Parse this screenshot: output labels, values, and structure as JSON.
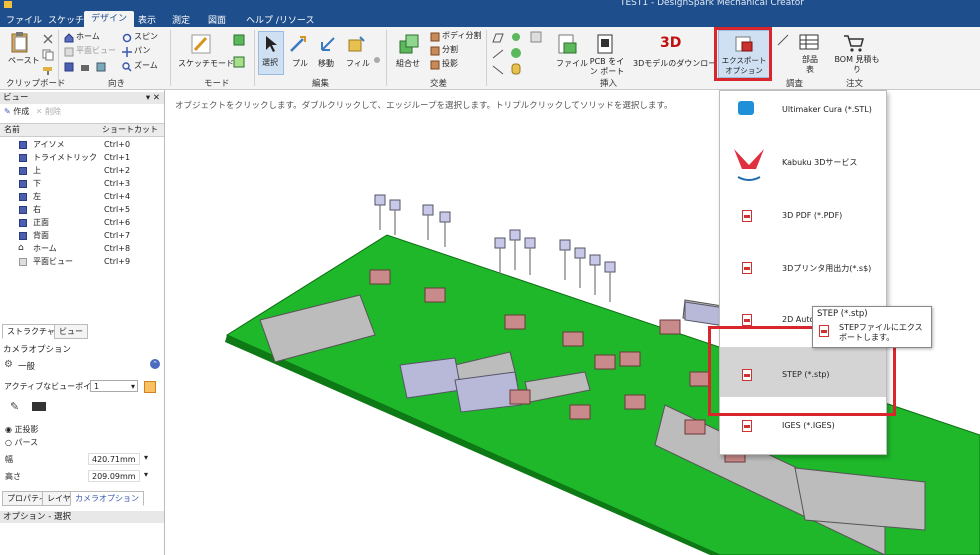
{
  "window": {
    "title": "TEST1 - DesignSpark Mechanical Creator"
  },
  "menu": {
    "tabs": [
      "ファイル",
      "スケッチ",
      "デザイン",
      "表示",
      "測定",
      "図面",
      "ヘルプ /リソース"
    ],
    "active": "デザイン"
  },
  "ribbon": {
    "clipboard": {
      "paste": "ペースト",
      "group": "クリップボード"
    },
    "orient": {
      "home": "ホーム",
      "plane_view": "平面ビュー",
      "spin": "スピン",
      "pan": "パン",
      "zoom": "ズーム",
      "group": "向き"
    },
    "mode": {
      "sketch_mode": "スケッチモード",
      "group": "モード"
    },
    "edit": {
      "select": "選択",
      "pull": "プル",
      "move": "移動",
      "fill": "フィル",
      "group": "編集"
    },
    "intersect": {
      "combine": "組合せ",
      "split_body": "ボディ分割",
      "split": "分割",
      "project": "投影",
      "group": "交差"
    },
    "insert": {
      "file": "ファイル",
      "pcb_import": "PCB をイン ポート",
      "3d_download": "3Dモデルのダウンロー",
      "group": "挿入"
    },
    "export_button": "エクスポート オプション",
    "parts": {
      "parts_table": "部品 表",
      "bom": "BOM 見積も り",
      "group_a": "調査",
      "group_b": "注文"
    }
  },
  "view_panel": {
    "title": "ビュー",
    "create": "作成",
    "delete": "削除",
    "columns": [
      "名前",
      "ショートカット"
    ],
    "rows": [
      {
        "name": "アイソメ",
        "key": "Ctrl+0"
      },
      {
        "name": "トライメトリック",
        "key": "Ctrl+1"
      },
      {
        "name": "上",
        "key": "Ctrl+2"
      },
      {
        "name": "下",
        "key": "Ctrl+3"
      },
      {
        "name": "左",
        "key": "Ctrl+4"
      },
      {
        "name": "右",
        "key": "Ctrl+5"
      },
      {
        "name": "正面",
        "key": "Ctrl+6"
      },
      {
        "name": "背面",
        "key": "Ctrl+7"
      },
      {
        "name": "ホーム",
        "key": "Ctrl+8"
      },
      {
        "name": "平面ビュー",
        "key": "Ctrl+9"
      }
    ],
    "tabs": [
      "ストラクチャー",
      "ビュー"
    ]
  },
  "camera": {
    "title": "カメラオプション",
    "section": "一般",
    "active_viewpoint_label": "アクティブなビューポイント",
    "active_viewpoint_value": "1",
    "ortho": "正投影",
    "perspective": "パース",
    "width_label": "幅",
    "width_value": "420.71mm",
    "height_label": "高さ",
    "height_value": "209.09mm"
  },
  "bottom_tabs": [
    "プロパティ",
    "レイヤ",
    "カメラオプション"
  ],
  "options_select": "オプション - 選択",
  "hint": "オブジェクトをクリックします。ダブルクリックして、エッジループを選択します。トリプルクリックしてソリッドを選択します。",
  "export_menu": [
    {
      "label": "Ultimaker Cura (*.STL)"
    },
    {
      "label": "Kabuku 3Dサービス"
    },
    {
      "label": "3D PDF (*.PDF)"
    },
    {
      "label": "3Dプリンタ用出力(*.s$)"
    },
    {
      "label": "2D AutoC"
    },
    {
      "label": "STEP (*.stp)"
    },
    {
      "label": "IGES (*.IGES)"
    }
  ],
  "tooltip": {
    "title": "STEP (*.stp)",
    "desc": "STEPファイルにエクスポートします。"
  },
  "colors": {
    "titlebar": "#1f4e8c",
    "pcb": "#1fb82a",
    "highlight": "#d9262c"
  }
}
